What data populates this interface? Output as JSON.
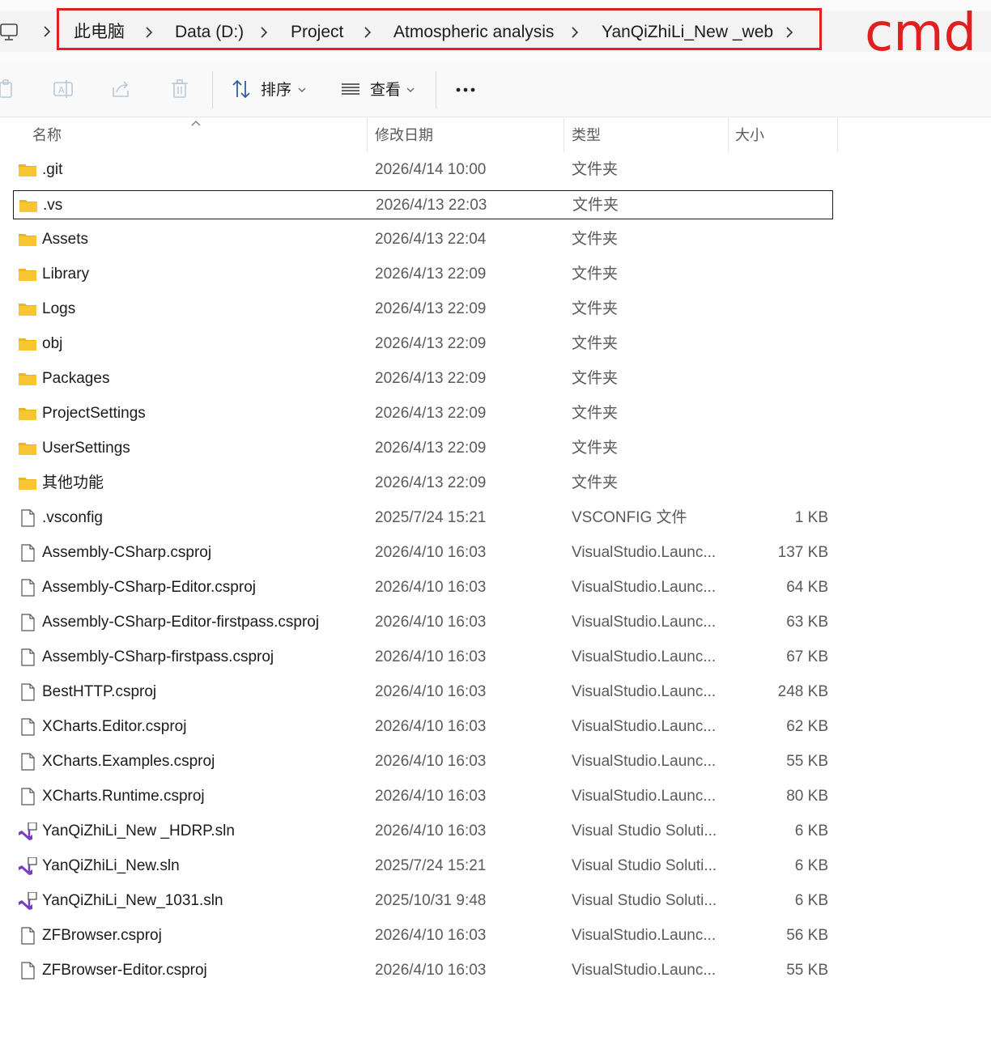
{
  "breadcrumb": [
    {
      "label": "此电脑"
    },
    {
      "label": "Data (D:)"
    },
    {
      "label": "Project"
    },
    {
      "label": "Atmospheric analysis"
    },
    {
      "label": "YanQiZhiLi_New _web"
    }
  ],
  "annotation": "cmd",
  "toolbar": {
    "sort_label": "排序",
    "view_label": "查看",
    "more_label": "..."
  },
  "columns": {
    "name": "名称",
    "date": "修改日期",
    "type": "类型",
    "size": "大小"
  },
  "files": [
    {
      "name": ".git",
      "date": "2026/4/14 10:00",
      "type": "文件夹",
      "size": "",
      "kind": "folder"
    },
    {
      "name": ".vs",
      "date": "2026/4/13 22:03",
      "type": "文件夹",
      "size": "",
      "kind": "folder",
      "selected": true
    },
    {
      "name": "Assets",
      "date": "2026/4/13 22:04",
      "type": "文件夹",
      "size": "",
      "kind": "folder"
    },
    {
      "name": "Library",
      "date": "2026/4/13 22:09",
      "type": "文件夹",
      "size": "",
      "kind": "folder"
    },
    {
      "name": "Logs",
      "date": "2026/4/13 22:09",
      "type": "文件夹",
      "size": "",
      "kind": "folder"
    },
    {
      "name": "obj",
      "date": "2026/4/13 22:09",
      "type": "文件夹",
      "size": "",
      "kind": "folder"
    },
    {
      "name": "Packages",
      "date": "2026/4/13 22:09",
      "type": "文件夹",
      "size": "",
      "kind": "folder"
    },
    {
      "name": "ProjectSettings",
      "date": "2026/4/13 22:09",
      "type": "文件夹",
      "size": "",
      "kind": "folder"
    },
    {
      "name": "UserSettings",
      "date": "2026/4/13 22:09",
      "type": "文件夹",
      "size": "",
      "kind": "folder"
    },
    {
      "name": "其他功能",
      "date": "2026/4/13 22:09",
      "type": "文件夹",
      "size": "",
      "kind": "folder"
    },
    {
      "name": ".vsconfig",
      "date": "2025/7/24 15:21",
      "type": "VSCONFIG 文件",
      "size": "1 KB",
      "kind": "file"
    },
    {
      "name": "Assembly-CSharp.csproj",
      "date": "2026/4/10 16:03",
      "type": "VisualStudio.Launc...",
      "size": "137 KB",
      "kind": "file"
    },
    {
      "name": "Assembly-CSharp-Editor.csproj",
      "date": "2026/4/10 16:03",
      "type": "VisualStudio.Launc...",
      "size": "64 KB",
      "kind": "file"
    },
    {
      "name": "Assembly-CSharp-Editor-firstpass.csproj",
      "date": "2026/4/10 16:03",
      "type": "VisualStudio.Launc...",
      "size": "63 KB",
      "kind": "file"
    },
    {
      "name": "Assembly-CSharp-firstpass.csproj",
      "date": "2026/4/10 16:03",
      "type": "VisualStudio.Launc...",
      "size": "67 KB",
      "kind": "file"
    },
    {
      "name": "BestHTTP.csproj",
      "date": "2026/4/10 16:03",
      "type": "VisualStudio.Launc...",
      "size": "248 KB",
      "kind": "file"
    },
    {
      "name": "XCharts.Editor.csproj",
      "date": "2026/4/10 16:03",
      "type": "VisualStudio.Launc...",
      "size": "62 KB",
      "kind": "file"
    },
    {
      "name": "XCharts.Examples.csproj",
      "date": "2026/4/10 16:03",
      "type": "VisualStudio.Launc...",
      "size": "55 KB",
      "kind": "file"
    },
    {
      "name": "XCharts.Runtime.csproj",
      "date": "2026/4/10 16:03",
      "type": "VisualStudio.Launc...",
      "size": "80 KB",
      "kind": "file"
    },
    {
      "name": "YanQiZhiLi_New _HDRP.sln",
      "date": "2026/4/10 16:03",
      "type": "Visual Studio Soluti...",
      "size": "6 KB",
      "kind": "sln"
    },
    {
      "name": "YanQiZhiLi_New.sln",
      "date": "2025/7/24 15:21",
      "type": "Visual Studio Soluti...",
      "size": "6 KB",
      "kind": "sln"
    },
    {
      "name": "YanQiZhiLi_New_1031.sln",
      "date": "2025/10/31 9:48",
      "type": "Visual Studio Soluti...",
      "size": "6 KB",
      "kind": "sln"
    },
    {
      "name": "ZFBrowser.csproj",
      "date": "2026/4/10 16:03",
      "type": "VisualStudio.Launc...",
      "size": "56 KB",
      "kind": "file"
    },
    {
      "name": "ZFBrowser-Editor.csproj",
      "date": "2026/4/10 16:03",
      "type": "VisualStudio.Launc...",
      "size": "55 KB",
      "kind": "file"
    }
  ],
  "colors": {
    "annotation_red": "#e02020",
    "folder_yellow": "#f8c630",
    "vs_purple": "#7a3cc2"
  }
}
